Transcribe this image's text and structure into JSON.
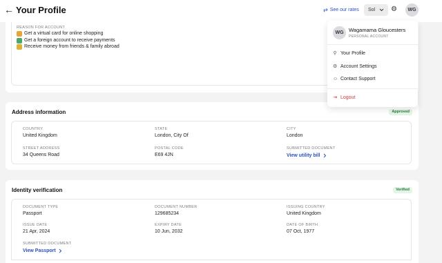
{
  "header": {
    "back_icon": "arrow-left-icon",
    "title": "Your Profile",
    "rates_link": "See our rates",
    "language": "Sol",
    "user_initials": "WG"
  },
  "reason": {
    "label": "REASON FOR ACCOUNT",
    "items": [
      {
        "text": "Get a virtual card for online shopping",
        "icon": "credit-card-icon",
        "color": "#e8a33a"
      },
      {
        "text": "Get a foreign account to receive payments",
        "icon": "bank-icon",
        "color": "#4aa86a"
      },
      {
        "text": "Receive money from friends & family abroad",
        "icon": "money-icon",
        "color": "#d9b23a"
      }
    ]
  },
  "address": {
    "title": "Address information",
    "status": "Approved",
    "fields": {
      "country_label": "COUNTRY",
      "country": "United Kingdom",
      "state_label": "STATE",
      "state": "London, City Of",
      "city_label": "CITY",
      "city": "London",
      "street_label": "STREET ADDRESS",
      "street": "34 Queens Road",
      "postal_label": "POSTAL CODE",
      "postal": "E69 4JN",
      "doc_label": "SUBMITTED DOCUMENT",
      "doc_link": "View utility bill"
    }
  },
  "identity": {
    "title": "Identity verification",
    "status": "Verified",
    "fields": {
      "doctype_label": "DOCUMENT TYPE",
      "doctype": "Passport",
      "docnum_label": "DOCUMENT NUMBER",
      "docnum": "129685234",
      "issuing_label": "ISSUING COUNTRY",
      "issuing": "United Kingdom",
      "issue_label": "ISSUE DATE",
      "issue": "21 Apr, 2024",
      "expiry_label": "EXPIRY DATE",
      "expiry": "10 Jun, 2032",
      "dob_label": "DATE OF BIRTH",
      "dob": "07 Oct, 1977",
      "doc_label": "SUBMITTED DOCUMENT",
      "doc_link": "View Passport"
    }
  },
  "menu": {
    "initials": "WG",
    "name": "Wagamama Gloucesters",
    "account_type": "PERSONAL ACCOUNT",
    "items": [
      {
        "label": "Your Profile",
        "icon": "user-icon"
      },
      {
        "label": "Account Settings",
        "icon": "settings-icon"
      },
      {
        "label": "Contact Support",
        "icon": "support-icon"
      }
    ],
    "logout": "Logout"
  },
  "colors": {
    "accent": "#2a4fc4",
    "success": "#2a7a3a",
    "danger": "#d23a3a"
  }
}
